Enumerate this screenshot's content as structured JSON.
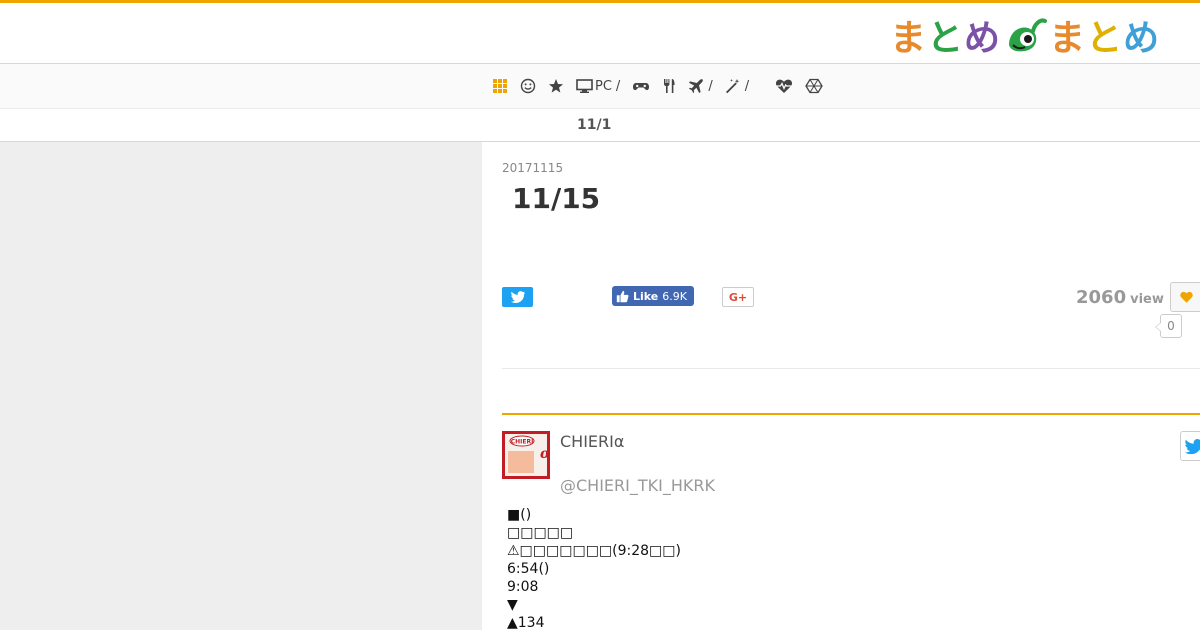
{
  "header": {
    "logo_text_left": "まとめ",
    "logo_text_right": "まとめ"
  },
  "nav": {
    "items": [
      {
        "icon": "grid-icon",
        "label": ""
      },
      {
        "icon": "smiley-icon",
        "label": ""
      },
      {
        "icon": "star-icon",
        "label": ""
      },
      {
        "icon": "monitor-icon",
        "label": "PC",
        "slash": "/"
      },
      {
        "icon": "gamepad-icon",
        "label": ""
      },
      {
        "icon": "utensils-icon",
        "label": ""
      },
      {
        "icon": "plane-icon",
        "label": "",
        "slash": "/"
      },
      {
        "icon": "magic-wand-icon",
        "label": "",
        "slash": "/"
      },
      {
        "icon": "heartbeat-icon",
        "label": ""
      },
      {
        "icon": "hexagon-icon",
        "label": ""
      }
    ]
  },
  "breadcrumb": {
    "text": "11/1"
  },
  "article": {
    "date": "20171115",
    "title": "11/15",
    "views": "2060",
    "views_unit": "view",
    "fav_count": "0"
  },
  "share": {
    "fb_like_label": "Like",
    "fb_count": "6.9K",
    "gplus_label": "G+"
  },
  "tweet": {
    "name": "CHIERIα",
    "handle": "@CHIERI_TKI_HKRK",
    "avatar_text": "CHIERI",
    "lines": [
      "■()",
      "□□□□□",
      "⚠□□□□□□□(9:28□□)",
      "6:54()",
      "9:08",
      "▼",
      "▲134"
    ]
  },
  "colors": {
    "accent": "#f0a400",
    "twitter": "#1da1f2",
    "facebook": "#4267b2",
    "gplus": "#dd4b39"
  }
}
